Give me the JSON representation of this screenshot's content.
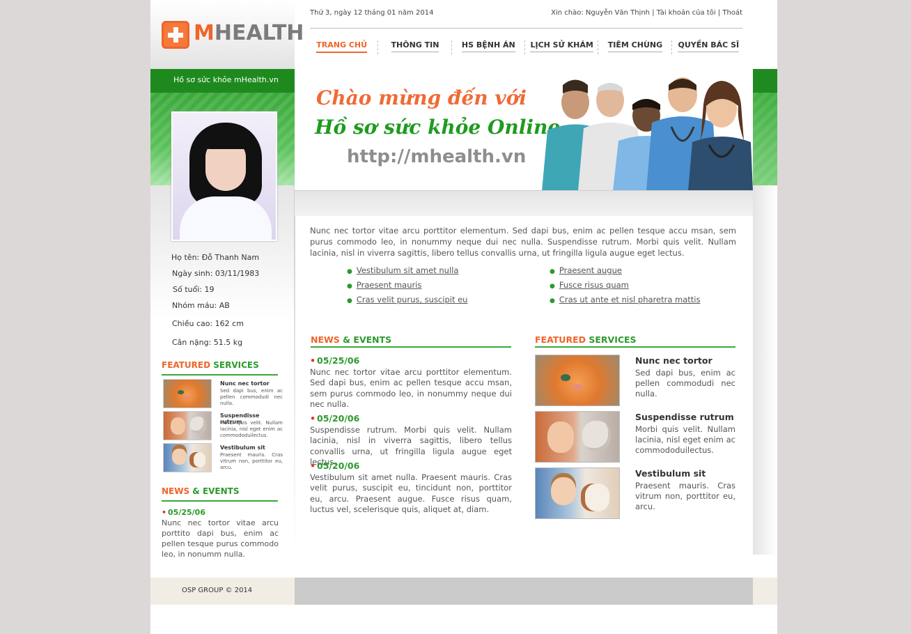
{
  "header": {
    "logo_brand_m": "M",
    "logo_brand_rest": "HEALTH",
    "site_tagline": "Hồ sơ sức khỏe  mHealth.vn",
    "date": "Thứ 3, ngày 12 tháng 01 năm 2014",
    "greeting": "Xin chào: Nguyễn Văn Thịnh",
    "sep": " | ",
    "account_link": "Tài khoản của tôi",
    "logout_link": "Thoát"
  },
  "nav": {
    "items": [
      {
        "label": "TRANG CHỦ",
        "active": true
      },
      {
        "label": "THÔNG TIN",
        "active": false
      },
      {
        "label": "HS BỆNH ÁN",
        "active": false
      },
      {
        "label": "LỊCH SỬ KHÁM",
        "active": false
      },
      {
        "label": "TIÊM CHÙNG",
        "active": false
      },
      {
        "label": "QUYỀN BÁC SĨ",
        "active": false
      }
    ]
  },
  "banner": {
    "line1": "Chào mừng đến với",
    "line2": "Hồ sơ sức khỏe Online",
    "line3": "http://mhealth.vn"
  },
  "profile": {
    "name": "Họ tên: Đỗ Thanh Nam",
    "dob": "Ngày sinh: 03/11/1983",
    "age": "Số tuổi: 19",
    "blood": "Nhóm máu: AB",
    "height": "Chiều cao: 162 cm",
    "weight": "Cân nặng: 51.5 kg"
  },
  "sidebar": {
    "featured_head_1": "FEATURED",
    "featured_head_2": " SERVICES",
    "services": [
      {
        "title": "Nunc nec tortor",
        "desc": "Sed dapi bus, enim ac pellen commodudi nec nulla."
      },
      {
        "title": "Suspendisse rutrum",
        "desc": "Morbi quis velit. Nullam lacinia, nisl eget enim ac commododuilectus."
      },
      {
        "title": "Vestibulum sit",
        "desc": "Praesent mauris. Cras vitrum non, porttitor eu, arcu."
      }
    ],
    "news_head_1": "NEWS",
    "news_head_2": " & EVENTS",
    "news_date": "05/25/06",
    "news_text": "Nunc nec tortor vitae arcu porttito dapi bus, enim ac pellen tesque purus commodo leo, in nonumm nulla."
  },
  "main": {
    "intro": "Nunc nec tortor vitae arcu porttitor elementum. Sed dapi bus, enim ac pellen tesque accu msan, sem purus commodo leo, in nonummy neque dui nec nulla. Suspendisse rutrum. Morbi quis velit. Nullam lacinia, nisl in viverra sagittis, libero tellus convallis urna, ut fringilla ligula augue eget lectus.",
    "links_col1": [
      "Vestibulum sit amet nulla",
      "Praesent mauris",
      "Cras velit purus, suscipit eu"
    ],
    "links_col2": [
      "Praesent augue",
      "Fusce risus quam",
      "Cras ut ante et nisl pharetra mattis"
    ],
    "news_head_1": "NEWS",
    "news_head_2": " & EVENTS",
    "news": [
      {
        "date": "05/25/06",
        "text": "Nunc nec tortor vitae arcu porttitor elementum. Sed dapi bus, enim ac pellen tesque accu msan, sem purus commodo leo, in nonummy neque dui nec nulla."
      },
      {
        "date": "05/20/06",
        "text": "Suspendisse rutrum. Morbi quis velit. Nullam lacinia, nisl in viverra sagittis, libero tellus convallis urna, ut fringilla ligula augue eget lectus."
      },
      {
        "date": "05/20/06",
        "text": "Vestibulum sit amet nulla. Praesent mauris. Cras velit purus, suscipit eu, tincidunt non, porttitor eu, arcu. Praesent augue. Fusce risus quam, luctus vel, scelerisque quis, aliquet at, diam."
      }
    ],
    "featured_head_1": "FEATURED",
    "featured_head_2": " SERVICES",
    "services": [
      {
        "title": "Nunc nec tortor",
        "desc": "Sed dapi bus, enim ac pellen commodudi nec nulla."
      },
      {
        "title": "Suspendisse rutrum",
        "desc": "Morbi quis velit. Nullam lacinia, nisl eget enim ac commododuilectus."
      },
      {
        "title": "Vestibulum sit",
        "desc": "Praesent mauris. Cras vitrum non, porttitor eu, arcu."
      }
    ]
  },
  "footer": {
    "copyright": "OSP GROUP © 2014"
  },
  "colors": {
    "accent_orange": "#f0642a",
    "accent_green": "#2c9a2c",
    "dark_green": "#1e8a1e"
  },
  "icons": [
    "medical-cross-icon",
    "bullet-icon"
  ]
}
